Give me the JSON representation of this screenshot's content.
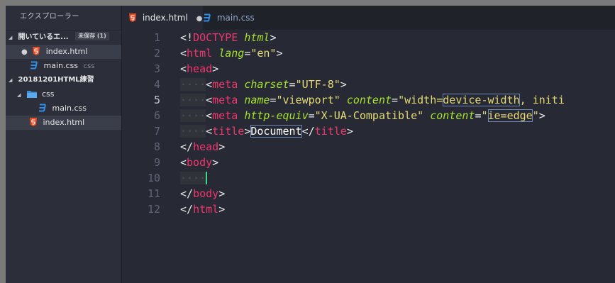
{
  "sidebar": {
    "title": "エクスプローラー",
    "open_editors": {
      "label": "開いているエ...",
      "badge": "未保存 (1)",
      "items": [
        {
          "name": "index.html",
          "dirty": "●"
        },
        {
          "name": "main.css",
          "hint": "css"
        }
      ]
    },
    "project": {
      "label": "20181201HTML練習",
      "folder": "css",
      "folder_items": [
        "main.css"
      ],
      "root_items": [
        "index.html"
      ]
    }
  },
  "tabs": [
    {
      "label": "index.html",
      "dirty": "●",
      "active": true
    },
    {
      "label": "main.css",
      "active": false
    }
  ],
  "editor": {
    "line_numbers": [
      "1",
      "2",
      "3",
      "4",
      "5",
      "6",
      "7",
      "8",
      "9",
      "10",
      "11",
      "12"
    ],
    "current_line": "5",
    "tokens": {
      "l1_a": "<!",
      "l1_b": "DOCTYPE",
      "l1_c": "html",
      "l1_d": ">",
      "l2_tag": "html",
      "l2_attr": "lang",
      "l2_val": "\"en\"",
      "l3_tag": "head",
      "l4_tag": "meta",
      "l4_attr": "charset",
      "l4_val": "\"UTF-8\"",
      "l5_tag": "meta",
      "l5_attr1": "name",
      "l5_val1": "\"viewport\"",
      "l5_attr2": "content",
      "l5_val2a": "\"width=",
      "l5_val2b": "device-width",
      "l5_val2c": ", initi",
      "l6_tag": "meta",
      "l6_attr1": "http-equiv",
      "l6_val1": "\"X-UA-Compatible\"",
      "l6_attr2": "content",
      "l6_val2a": "\"",
      "l6_val2b": "ie=edge",
      "l6_val2c": "\"",
      "l7_tag": "title",
      "l7_text": "Document",
      "l7_close": "title",
      "l8_tag": "head",
      "l9_tag": "body",
      "l11_tag": "body",
      "l12_tag": "html",
      "indent": "····"
    }
  },
  "colors": {
    "tag": "#f0366e",
    "attribute": "#a6e22e",
    "string": "#e6db74",
    "caret": "#3ddc84",
    "html_icon": "#e44d26",
    "css_icon": "#2f8fe8"
  }
}
